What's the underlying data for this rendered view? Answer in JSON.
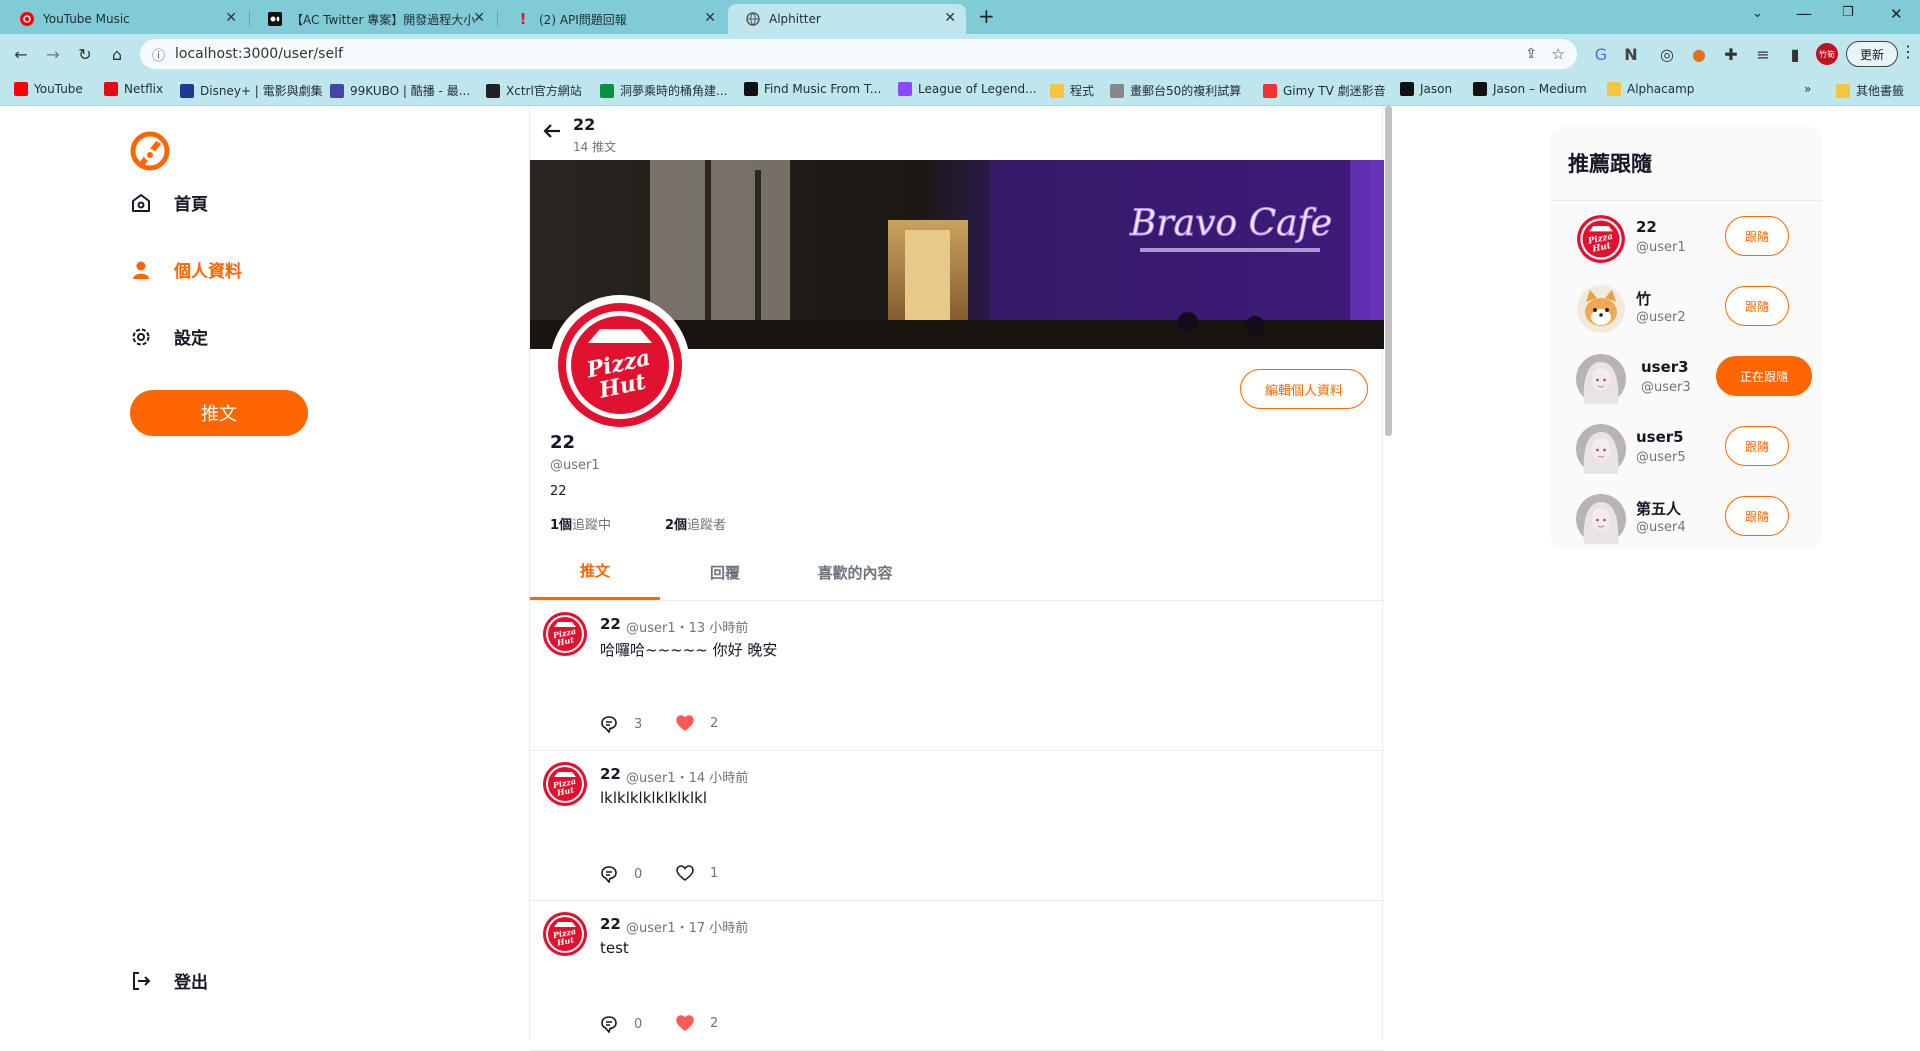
{
  "browser": {
    "tabs": [
      {
        "title": "YouTube Music",
        "icon": "youtube-music-icon"
      },
      {
        "title": "【AC Twitter 專案】開發過程大小",
        "icon": "medium-icon"
      },
      {
        "title": "(2) API問題回報",
        "icon": "exclamation-icon"
      },
      {
        "title": "Alphitter",
        "icon": "globe-icon"
      }
    ],
    "url": "localhost:3000/user/self",
    "update_label": "更新",
    "profile_badge": "竹筍",
    "bookmarks": [
      {
        "label": "YouTube",
        "color": "#ff0000"
      },
      {
        "label": "Netflix",
        "color": "#e50914"
      },
      {
        "label": "Disney+ | 電影與劇集",
        "color": "#1d3c8f"
      },
      {
        "label": "99KUBO | 酷播 - 最...",
        "color": "#44a"
      },
      {
        "label": "Xctrl官方網站",
        "color": "#222"
      },
      {
        "label": "洞夢乘時的桶角建...",
        "color": "#0a8f3c"
      },
      {
        "label": "Find Music From T...",
        "color": "#111"
      },
      {
        "label": "League of Legend...",
        "color": "#9146ff"
      },
      {
        "label": "程式",
        "color": "#f4c542"
      },
      {
        "label": "畫郵台50的複利試算",
        "color": "#888"
      },
      {
        "label": "Gimy TV 劇迷影音",
        "color": "#e33"
      },
      {
        "label": "Jason",
        "color": "#111"
      },
      {
        "label": "Jason – Medium",
        "color": "#111"
      },
      {
        "label": "Alphacamp",
        "color": "#f4c542"
      }
    ],
    "other_bookmarks": "其他書籤"
  },
  "sidebar": {
    "items": [
      {
        "label": "首頁",
        "icon": "home-icon",
        "active": false
      },
      {
        "label": "個人資料",
        "icon": "user-icon",
        "active": true
      },
      {
        "label": "設定",
        "icon": "gear-icon",
        "active": false
      }
    ],
    "tweet_button": "推文",
    "logout": "登出"
  },
  "profile": {
    "header_name": "22",
    "header_count": "14 推文",
    "cover_sign": "Bravo Cafe",
    "edit_button": "編輯個人資料",
    "name": "22",
    "handle": "@user1",
    "bio": "22",
    "following_count": "1個",
    "following_label": "追蹤中",
    "followers_count": "2個",
    "followers_label": "追蹤者",
    "tabs": [
      "推文",
      "回覆",
      "喜歡的內容"
    ],
    "avatar_text": [
      "Pizza",
      "Hut"
    ]
  },
  "tweets": [
    {
      "name": "22",
      "meta": "@user1・13 小時前",
      "text": "哈囉哈~~~~~ 你好 晚安",
      "replies": "3",
      "likes": "2",
      "liked": true
    },
    {
      "name": "22",
      "meta": "@user1・14 小時前",
      "text": "lklklklklklklklkl",
      "replies": "0",
      "likes": "1",
      "liked": false
    },
    {
      "name": "22",
      "meta": "@user1・17 小時前",
      "text": "test",
      "replies": "0",
      "likes": "2",
      "liked": true
    }
  ],
  "recommend": {
    "title": "推薦跟隨",
    "users": [
      {
        "name": "22",
        "handle": "@user1",
        "button": "跟隨",
        "following": false,
        "avatar": "pizza-hut"
      },
      {
        "name": "竹",
        "handle": "@user2",
        "button": "跟隨",
        "following": false,
        "avatar": "shiba"
      },
      {
        "name": "user3",
        "handle": "@user3",
        "button": "正在跟隨",
        "following": true,
        "avatar": "girl"
      },
      {
        "name": "user5",
        "handle": "@user5",
        "button": "跟隨",
        "following": false,
        "avatar": "girl"
      },
      {
        "name": "第五人",
        "handle": "@user4",
        "button": "跟隨",
        "following": false,
        "avatar": "girl"
      }
    ]
  },
  "colors": {
    "brand": "#ff6600",
    "like": "#fc5a5a",
    "pizza_red": "#e1122f"
  }
}
